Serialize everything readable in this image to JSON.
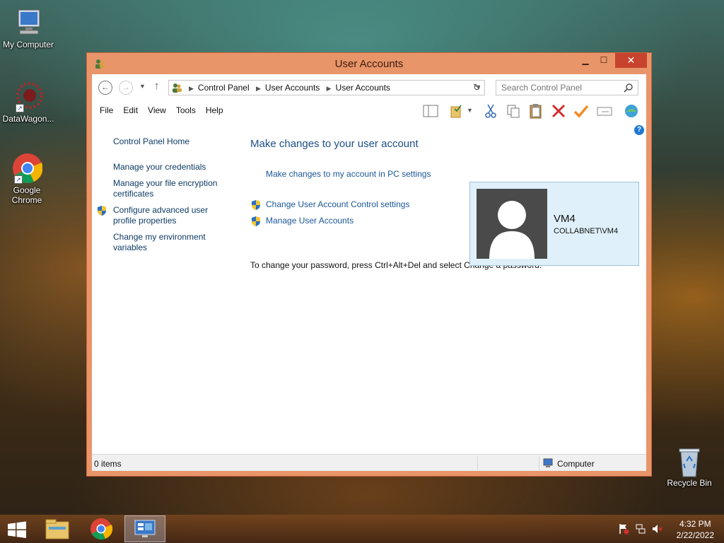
{
  "desktop": {
    "icons": [
      {
        "label": "My Computer"
      },
      {
        "label": "DataWagon..."
      },
      {
        "label": "Google Chrome"
      },
      {
        "label": "Recycle Bin"
      }
    ]
  },
  "window": {
    "title": "User Accounts",
    "close_glyph": "✕",
    "nav": {
      "breadcrumbs": [
        "Control Panel",
        "User Accounts",
        "User Accounts"
      ],
      "search_placeholder": "Search Control Panel"
    },
    "menu": [
      "File",
      "Edit",
      "View",
      "Tools",
      "Help"
    ],
    "toolbar_icons": [
      "preview-pane-icon",
      "folder-options-icon",
      "cut-icon",
      "copy-icon",
      "paste-icon",
      "delete-icon",
      "properties-check-icon",
      "rename-icon",
      "internet-icon"
    ],
    "help_glyph": "?",
    "left_pane": {
      "home": "Control Panel Home",
      "links": [
        "Manage your credentials",
        "Manage your file encryption certificates",
        "Configure advanced user profile properties",
        "Change my environment variables"
      ]
    },
    "main": {
      "heading": "Make changes to your user account",
      "pc_settings_link": "Make changes to my account in PC settings",
      "uac_link": "Change User Account Control settings",
      "manage_link": "Manage User Accounts",
      "note": "To change your password, press Ctrl+Alt+Del and select Change a password."
    },
    "user": {
      "name": "VM4",
      "domain": "COLLABNET\\VM4"
    },
    "status": {
      "items": "0 items",
      "zone": "Computer"
    }
  },
  "taskbar": {
    "time": "4:32 PM",
    "date": "2/22/2022"
  },
  "colors": {
    "window_frame": "#e9956a",
    "close_button": "#c7432e",
    "link": "#1a5797",
    "heading": "#1d4f86",
    "user_card": "#dff0fa"
  }
}
